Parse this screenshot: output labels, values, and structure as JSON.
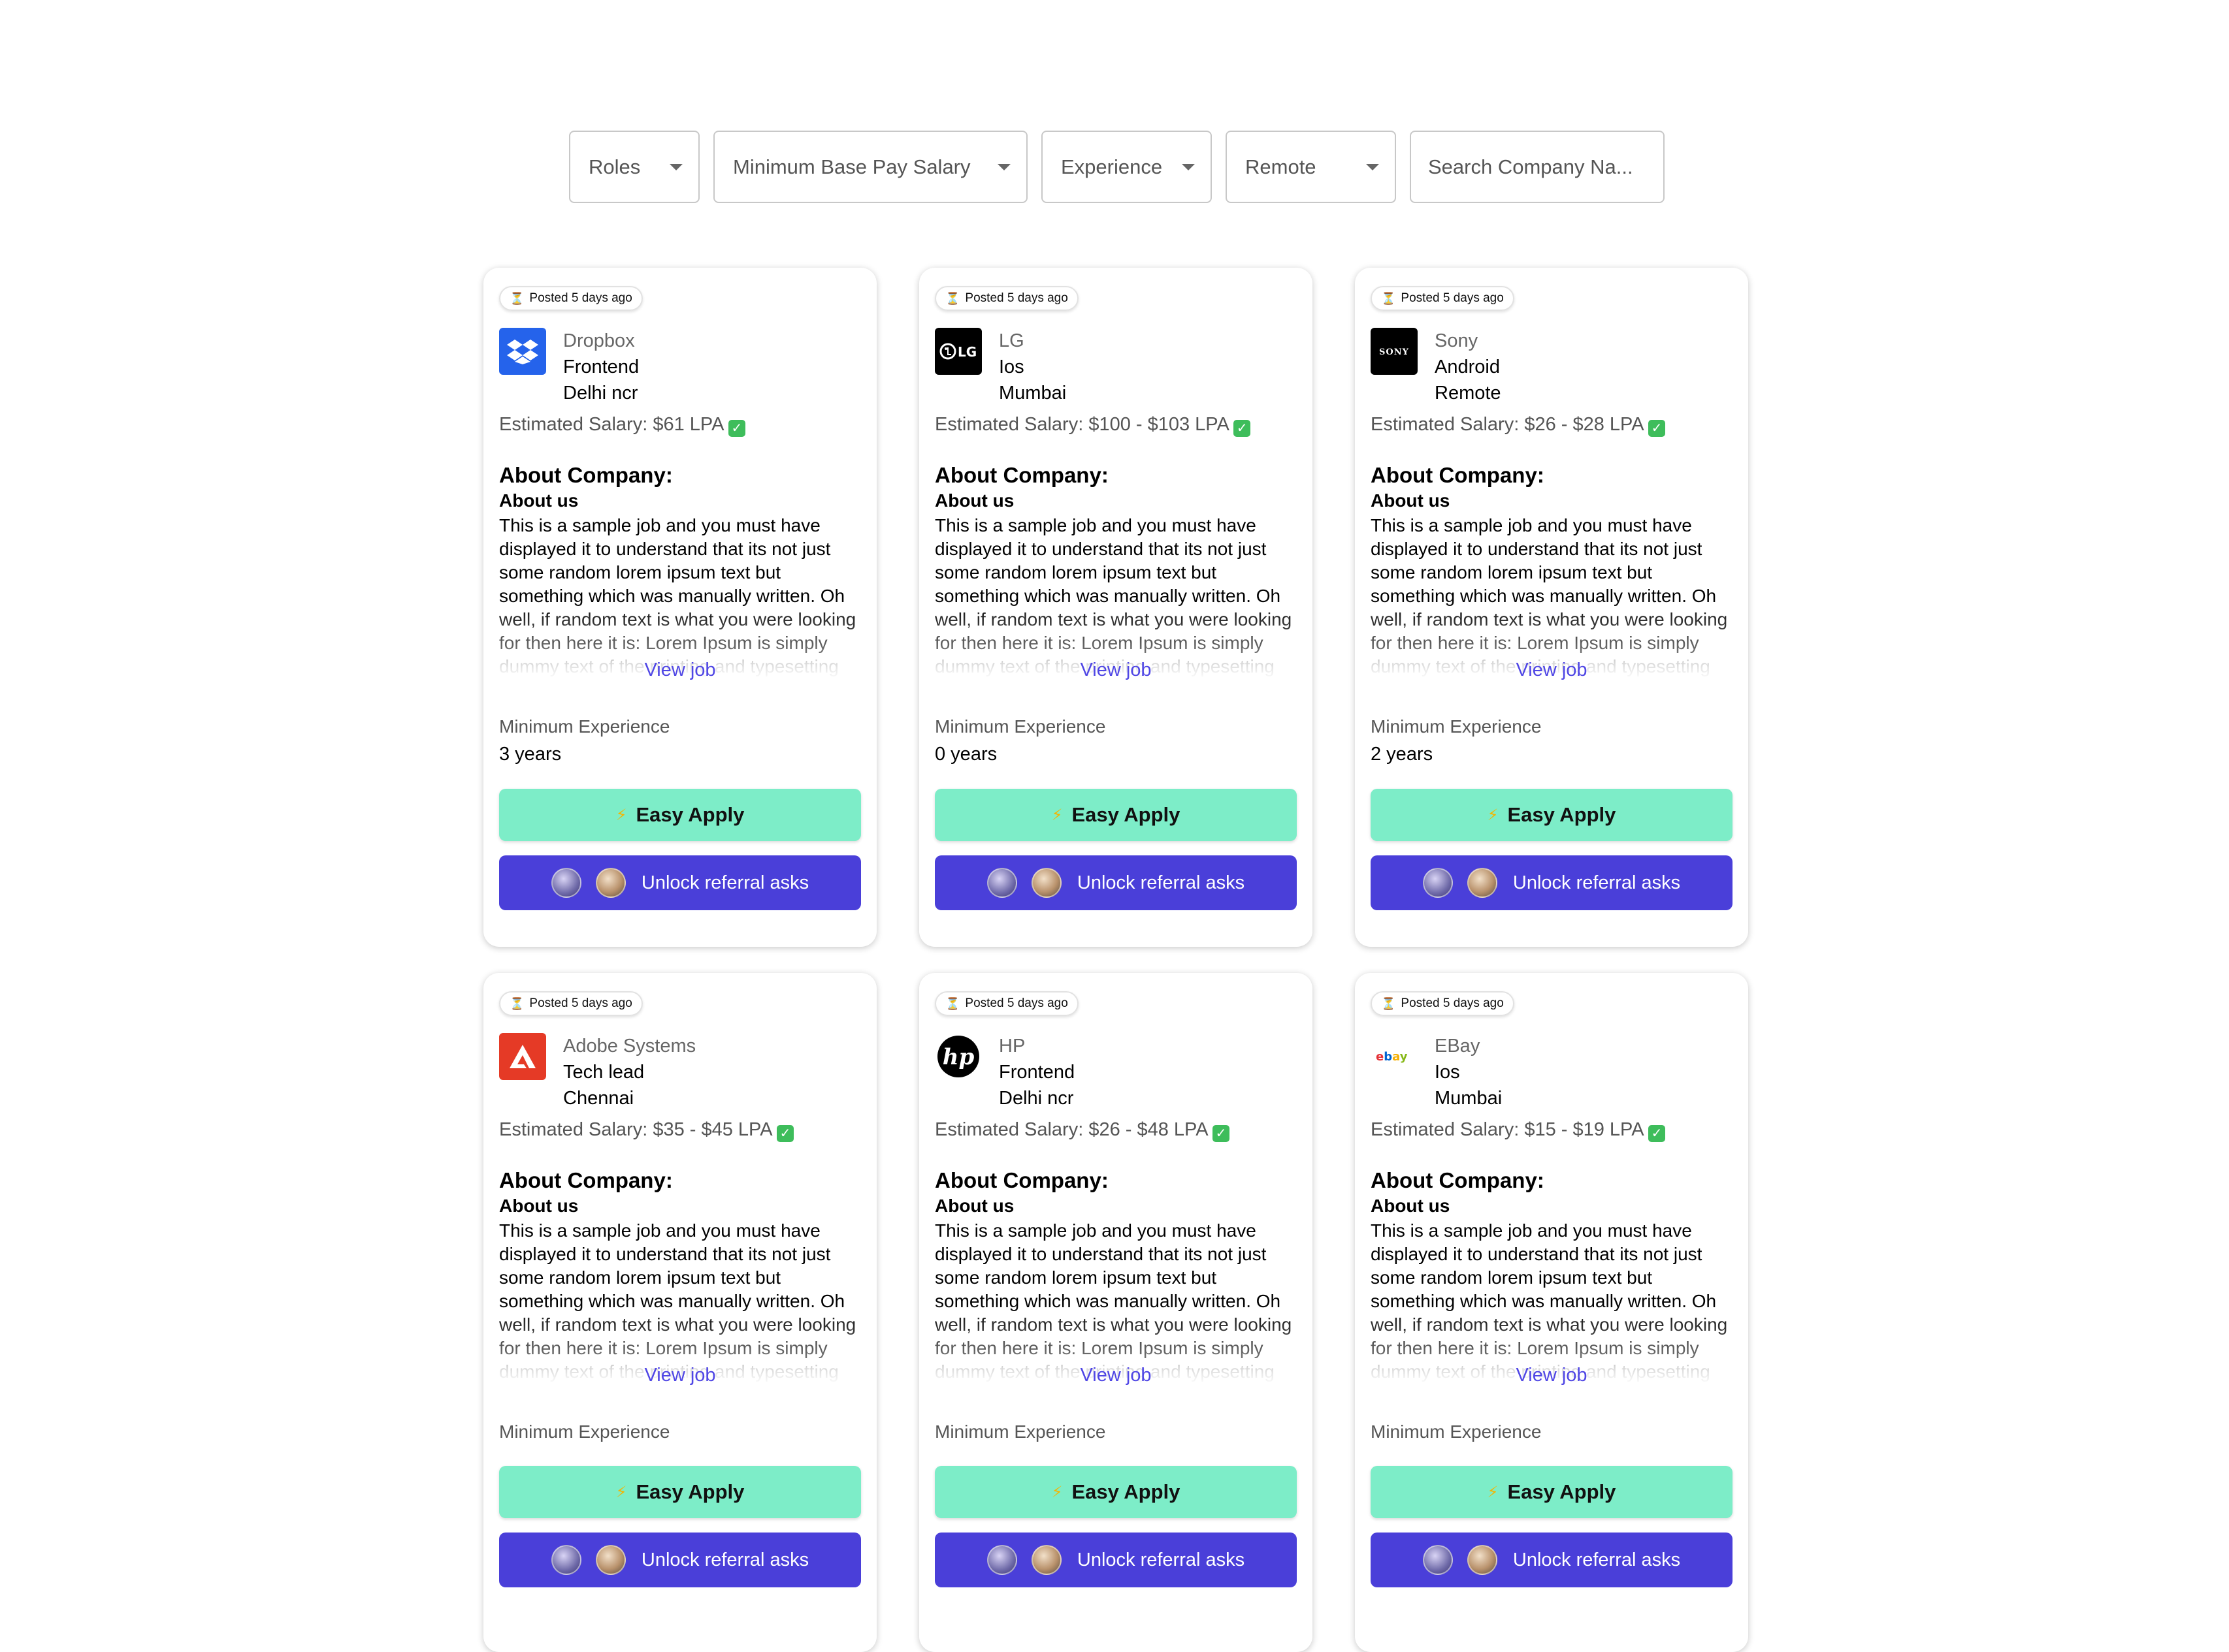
{
  "filters": {
    "roles": "Roles",
    "min_pay": "Minimum Base Pay Salary",
    "experience": "Experience",
    "remote": "Remote",
    "search_placeholder": "Search Company Na..."
  },
  "jobs": [
    {
      "posted": "Posted 5 days ago",
      "company": "Dropbox",
      "role": "Frontend",
      "location": "Delhi ncr",
      "salary": "Estimated Salary: $61 LPA",
      "about_heading": "About Company:",
      "about_sub": "About us",
      "about_text": "This is a sample job and you must have displayed it to understand that its not just some random lorem ipsum text but something which was manually written. Oh well, if random text is what you were looking for then here it is: Lorem Ipsum is simply dummy text of the printing and typesetting industry. Lorem Ipsum",
      "view_job": "View job",
      "min_exp_label": "Minimum Experience",
      "min_exp": "3 years",
      "easy_apply": "Easy Apply",
      "referral": "Unlock referral asks",
      "logo_icon": "dropbox-logo"
    },
    {
      "posted": "Posted 5 days ago",
      "company": "LG",
      "role": "Ios",
      "location": "Mumbai",
      "salary": "Estimated Salary: $100 - $103 LPA",
      "about_heading": "About Company:",
      "about_sub": "About us",
      "about_text": "This is a sample job and you must have displayed it to understand that its not just some random lorem ipsum text but something which was manually written. Oh well, if random text is what you were looking for then here it is: Lorem Ipsum is simply dummy text of the printing and typesetting industry. Lorem Ipsum",
      "view_job": "View job",
      "min_exp_label": "Minimum Experience",
      "min_exp": "0 years",
      "easy_apply": "Easy Apply",
      "referral": "Unlock referral asks",
      "logo_icon": "lg-logo"
    },
    {
      "posted": "Posted 5 days ago",
      "company": "Sony",
      "role": "Android",
      "location": "Remote",
      "salary": "Estimated Salary: $26 - $28 LPA",
      "about_heading": "About Company:",
      "about_sub": "About us",
      "about_text": "This is a sample job and you must have displayed it to understand that its not just some random lorem ipsum text but something which was manually written. Oh well, if random text is what you were looking for then here it is: Lorem Ipsum is simply dummy text of the printing and typesetting industry. Lorem Ipsum",
      "view_job": "View job",
      "min_exp_label": "Minimum Experience",
      "min_exp": "2 years",
      "easy_apply": "Easy Apply",
      "referral": "Unlock referral asks",
      "logo_icon": "sony-logo"
    },
    {
      "posted": "Posted 5 days ago",
      "company": "Adobe Systems",
      "role": "Tech lead",
      "location": "Chennai",
      "salary": "Estimated Salary: $35 - $45 LPA",
      "about_heading": "About Company:",
      "about_sub": "About us",
      "about_text": "This is a sample job and you must have displayed it to understand that its not just some random lorem ipsum text but something which was manually written. Oh well, if random text is what you were looking for then here it is: Lorem Ipsum is simply dummy text of the printing and typesetting industry. Lorem Ipsum",
      "view_job": "View job",
      "min_exp_label": "Minimum Experience",
      "min_exp": "",
      "easy_apply": "Easy Apply",
      "referral": "Unlock referral asks",
      "logo_icon": "adobe-logo"
    },
    {
      "posted": "Posted 5 days ago",
      "company": "HP",
      "role": "Frontend",
      "location": "Delhi ncr",
      "salary": "Estimated Salary: $26 - $48 LPA",
      "about_heading": "About Company:",
      "about_sub": "About us",
      "about_text": "This is a sample job and you must have displayed it to understand that its not just some random lorem ipsum text but something which was manually written. Oh well, if random text is what you were looking for then here it is: Lorem Ipsum is simply dummy text of the printing and typesetting industry. Lorem Ipsum",
      "view_job": "View job",
      "min_exp_label": "Minimum Experience",
      "min_exp": "",
      "easy_apply": "Easy Apply",
      "referral": "Unlock referral asks",
      "logo_icon": "hp-logo"
    },
    {
      "posted": "Posted 5 days ago",
      "company": "EBay",
      "role": "Ios",
      "location": "Mumbai",
      "salary": "Estimated Salary: $15 - $19 LPA",
      "about_heading": "About Company:",
      "about_sub": "About us",
      "about_text": "This is a sample job and you must have displayed it to understand that its not just some random lorem ipsum text but something which was manually written. Oh well, if random text is what you were looking for then here it is: Lorem Ipsum is simply dummy text of the printing and typesetting industry. Lorem Ipsum",
      "view_job": "View job",
      "min_exp_label": "Minimum Experience",
      "min_exp": "",
      "easy_apply": "Easy Apply",
      "referral": "Unlock referral asks",
      "logo_icon": "ebay-logo"
    }
  ],
  "colors": {
    "easy_apply_bg": "#7dedc8",
    "referral_bg": "#4a3fd9",
    "link": "#4f46e5",
    "salary_check": "#3ebd5b"
  }
}
